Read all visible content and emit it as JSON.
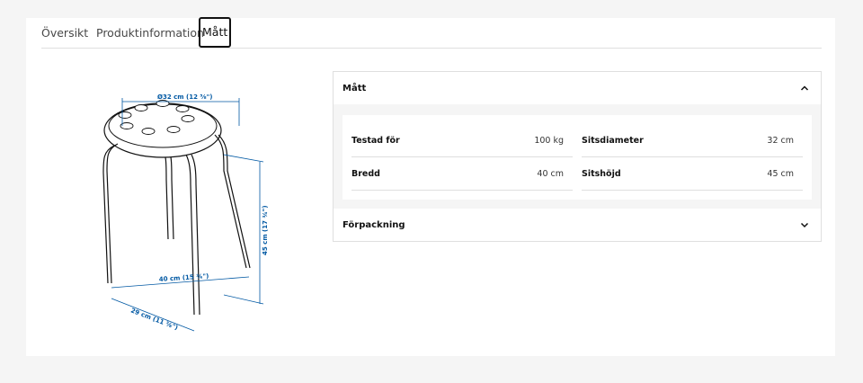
{
  "tabs": [
    {
      "label": "Översikt",
      "active": false
    },
    {
      "label": "Produktinformation",
      "active": false
    },
    {
      "label": "Mått",
      "active": true
    }
  ],
  "illustration": {
    "dim_diameter": "Ø32 cm (12 ⅝\")",
    "dim_height": "45 cm (17 ¾\")",
    "dim_width": "40 cm (15 ¾\")",
    "dim_depth": "29 cm (11 ⅜\")"
  },
  "accordion": {
    "matt": {
      "title": "Mått",
      "expanded": true,
      "specs_left": [
        {
          "label": "Testad för",
          "value": "100 kg"
        },
        {
          "label": "Bredd",
          "value": "40 cm"
        }
      ],
      "specs_right": [
        {
          "label": "Sitsdiameter",
          "value": "32 cm"
        },
        {
          "label": "Sitshöjd",
          "value": "45 cm"
        }
      ]
    },
    "packaging": {
      "title": "Förpackning",
      "expanded": false
    }
  },
  "colors": {
    "dimension": "#0058a3",
    "border": "#dfdfdf",
    "background": "#f5f5f5"
  }
}
